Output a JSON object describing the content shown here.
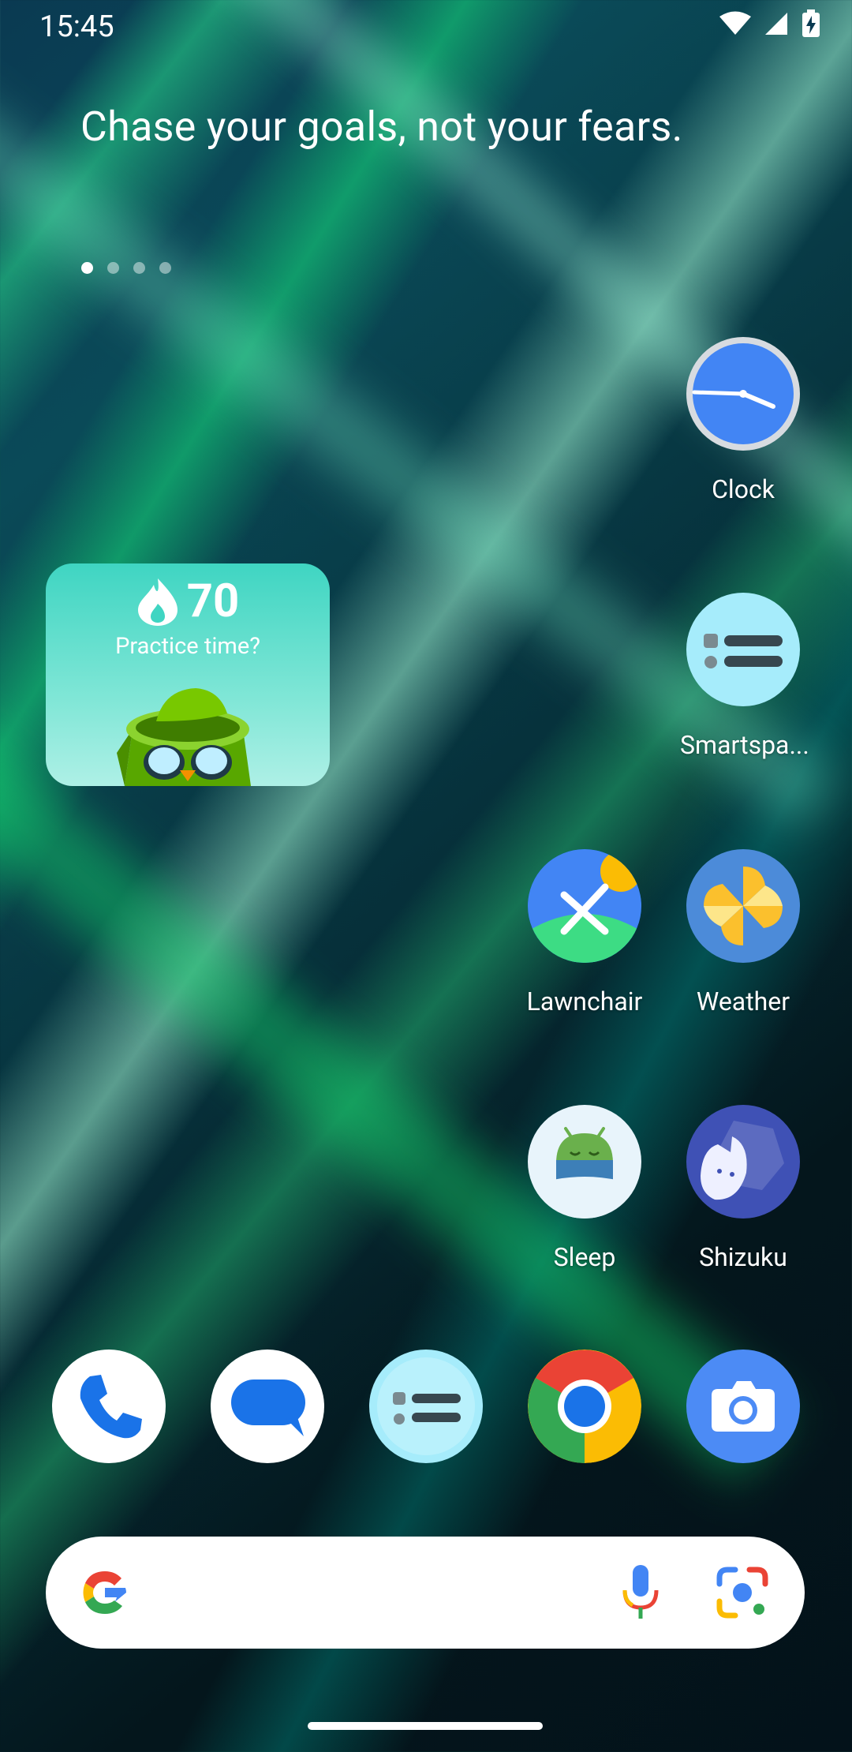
{
  "status_bar": {
    "time": "15:45",
    "icons": [
      "wifi-icon",
      "signal-icon",
      "battery-charging-icon"
    ]
  },
  "quote": "Chase your goals, not your fears.",
  "page_dots": {
    "count": 4,
    "active": 0
  },
  "widget": {
    "streak": "70",
    "prompt": "Practice time?"
  },
  "apps": [
    {
      "key": "clock",
      "label": "Clock"
    },
    {
      "key": "smartspacer",
      "label": "Smartspa..."
    },
    {
      "key": "lawnchair",
      "label": "Lawnchair"
    },
    {
      "key": "weather",
      "label": "Weather"
    },
    {
      "key": "sleep",
      "label": "Sleep"
    },
    {
      "key": "shizuku",
      "label": "Shizuku"
    }
  ],
  "dock": [
    "phone-icon",
    "messages-icon",
    "smartspacer-icon",
    "chrome-icon",
    "camera-icon"
  ],
  "search": {
    "icons": [
      "google-logo-icon",
      "microphone-icon",
      "lens-icon"
    ]
  },
  "colors": {
    "accent_blue": "#4285f4",
    "widget_teal": "#3fd5c2",
    "smartspacer_bg": "#a6ecfb"
  }
}
